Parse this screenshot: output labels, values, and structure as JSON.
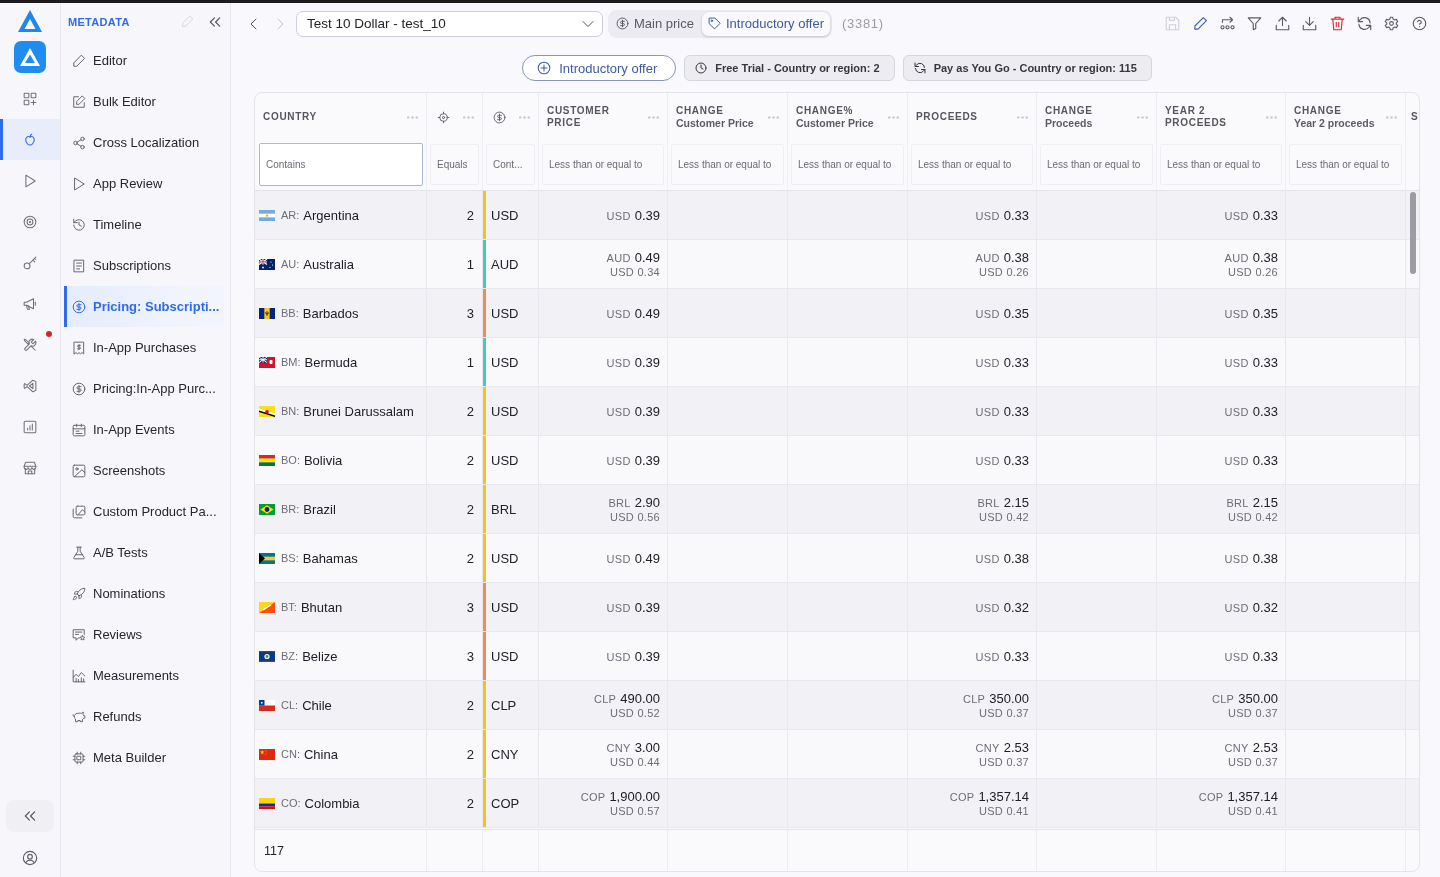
{
  "rail": {
    "items": [
      {
        "kind": "grid",
        "selected": false,
        "badge": false
      },
      {
        "kind": "apple",
        "selected": true,
        "badge": false
      },
      {
        "kind": "play",
        "selected": false,
        "badge": false
      },
      {
        "kind": "target",
        "selected": false,
        "badge": false
      },
      {
        "kind": "key",
        "selected": false,
        "badge": false
      },
      {
        "kind": "megaphone",
        "selected": false,
        "badge": false
      },
      {
        "kind": "tools",
        "selected": false,
        "badge": true
      },
      {
        "kind": "code",
        "selected": false,
        "badge": false
      },
      {
        "kind": "barchart",
        "selected": false,
        "badge": false
      },
      {
        "kind": "store",
        "selected": false,
        "badge": false
      }
    ]
  },
  "nav": {
    "title": "METADATA",
    "items": [
      {
        "kind": "pencil",
        "label": "Editor",
        "selected": false
      },
      {
        "kind": "edit",
        "label": "Bulk Editor",
        "selected": false
      },
      {
        "kind": "share",
        "label": "Cross Localization",
        "selected": false
      },
      {
        "kind": "play",
        "label": "App Review",
        "selected": false
      },
      {
        "kind": "history",
        "label": "Timeline",
        "selected": false
      },
      {
        "kind": "document",
        "label": "Subscriptions",
        "selected": false
      },
      {
        "kind": "dollar",
        "label": "Pricing: Subscripti...",
        "selected": true
      },
      {
        "kind": "receipt",
        "label": "In-App Purchases",
        "selected": false
      },
      {
        "kind": "dollar",
        "label": "Pricing:In-App Purc...",
        "selected": false
      },
      {
        "kind": "calendar",
        "label": "In-App Events",
        "selected": false
      },
      {
        "kind": "image",
        "label": "Screenshots",
        "selected": false
      },
      {
        "kind": "images",
        "label": "Custom Product Pa...",
        "selected": false
      },
      {
        "kind": "flask",
        "label": "A/B Tests",
        "selected": false
      },
      {
        "kind": "rocket",
        "label": "Nominations",
        "selected": false
      },
      {
        "kind": "review",
        "label": "Reviews",
        "selected": false
      },
      {
        "kind": "chart",
        "label": "Measurements",
        "selected": false
      },
      {
        "kind": "piggybank",
        "label": "Refunds",
        "selected": false
      },
      {
        "kind": "chip",
        "label": "Meta Builder",
        "selected": false
      }
    ]
  },
  "toolbar": {
    "history": [
      {
        "kind": "back",
        "disabled": false
      },
      {
        "kind": "forward",
        "disabled": true
      }
    ],
    "product_select": {
      "value": "Test 10 Dollar - test_10"
    },
    "price_types": [
      {
        "kind": "dollar",
        "label": "Main price",
        "selected": false
      },
      {
        "kind": "tag",
        "label": "Introductory offer",
        "selected": true
      }
    ],
    "count": "(3381)",
    "actions": [
      {
        "kind": "save",
        "disabled": true
      },
      {
        "kind": "pencil",
        "disabled": false
      },
      {
        "kind": "batch",
        "disabled": false
      },
      {
        "kind": "filter",
        "disabled": false
      },
      {
        "kind": "upload",
        "disabled": false
      },
      {
        "kind": "download",
        "disabled": false
      },
      {
        "kind": "delete",
        "disabled": false
      },
      {
        "kind": "refresh",
        "disabled": false
      },
      {
        "kind": "settings",
        "disabled": false
      },
      {
        "kind": "help",
        "disabled": false
      }
    ]
  },
  "offer_tabs": [
    {
      "kind": "add",
      "label": "Introductory offer",
      "selected": true
    },
    {
      "kind": "clock",
      "label": "Free Trial - Country or region: 2",
      "selected": false
    },
    {
      "kind": "refresh",
      "label": "Pay as You Go - Country or region: 115",
      "selected": false
    }
  ],
  "table": {
    "columns": [
      {
        "kind": "text",
        "title": "COUNTRY",
        "menu": true,
        "filter": {
          "placeholder": "Contains",
          "focused": true
        }
      },
      {
        "kind": "crosshair",
        "menu": true,
        "filter": {
          "placeholder": "Equals",
          "focused": false
        }
      },
      {
        "kind": "dollar",
        "menu": true,
        "filter": {
          "placeholder": "Cont...",
          "focused": false
        }
      },
      {
        "kind": "text",
        "title": "CUSTOMER PRICE",
        "menu": true,
        "filter": {
          "placeholder": "Less than or equal to",
          "focused": false
        }
      },
      {
        "kind": "text",
        "title": "CHANGE",
        "subtitle": "Customer Price",
        "menu": true,
        "filter": {
          "placeholder": "Less than or equal to",
          "focused": false
        }
      },
      {
        "kind": "text",
        "title": "CHANGE%",
        "subtitle": "Customer Price",
        "menu": true,
        "filter": {
          "placeholder": "Less than or equal to",
          "focused": false
        }
      },
      {
        "kind": "text",
        "title": "PROCEEDS",
        "menu": true,
        "filter": {
          "placeholder": "Less than or equal to",
          "focused": false
        }
      },
      {
        "kind": "text",
        "title": "CHANGE",
        "subtitle": "Proceeds",
        "menu": true,
        "filter": {
          "placeholder": "Less than or equal to",
          "focused": false
        }
      },
      {
        "kind": "text",
        "title": "YEAR 2 PROCEEDS",
        "menu": true,
        "filter": {
          "placeholder": "Less than or equal to",
          "focused": false
        }
      },
      {
        "kind": "text",
        "title": "CHANGE",
        "subtitle": "Year 2 proceeds",
        "menu": true,
        "filter": {
          "placeholder": "Less than or equal to",
          "focused": false
        }
      },
      {
        "kind": "text",
        "title": "S",
        "menu": false
      }
    ],
    "rows": [
      {
        "country": {
          "code": "AR:",
          "name": "Argentina"
        },
        "column_2": "2",
        "color": "#f5c21b",
        "column_3": "USD",
        "customer_price": {
          "code": "USD",
          "amount": "0.39"
        },
        "proceeds": {
          "code": "USD",
          "amount": "0.33"
        },
        "year_2_proceeds": {
          "code": "USD",
          "amount": "0.33"
        }
      },
      {
        "country": {
          "code": "AU:",
          "name": "Australia"
        },
        "column_2": "1",
        "color": "#3ccfbd",
        "column_3": "AUD",
        "customer_price": {
          "code": "AUD",
          "amount": "0.49",
          "converted": "USD 0.34"
        },
        "proceeds": {
          "code": "AUD",
          "amount": "0.38",
          "converted": "USD 0.26"
        },
        "year_2_proceeds": {
          "code": "AUD",
          "amount": "0.38",
          "converted": "USD 0.26"
        }
      },
      {
        "country": {
          "code": "BB:",
          "name": "Barbados"
        },
        "column_2": "3",
        "color": "#f28b4e",
        "column_3": "USD",
        "customer_price": {
          "code": "USD",
          "amount": "0.49"
        },
        "proceeds": {
          "code": "USD",
          "amount": "0.35"
        },
        "year_2_proceeds": {
          "code": "USD",
          "amount": "0.35"
        }
      },
      {
        "country": {
          "code": "BM:",
          "name": "Bermuda"
        },
        "column_2": "1",
        "color": "#3ccfbd",
        "column_3": "USD",
        "customer_price": {
          "code": "USD",
          "amount": "0.39"
        },
        "proceeds": {
          "code": "USD",
          "amount": "0.33"
        },
        "year_2_proceeds": {
          "code": "USD",
          "amount": "0.33"
        }
      },
      {
        "country": {
          "code": "BN:",
          "name": "Brunei Darussalam"
        },
        "column_2": "2",
        "color": "#f5c21b",
        "column_3": "USD",
        "customer_price": {
          "code": "USD",
          "amount": "0.39"
        },
        "proceeds": {
          "code": "USD",
          "amount": "0.33"
        },
        "year_2_proceeds": {
          "code": "USD",
          "amount": "0.33"
        }
      },
      {
        "country": {
          "code": "BO:",
          "name": "Bolivia"
        },
        "column_2": "2",
        "color": "#f5c21b",
        "column_3": "USD",
        "customer_price": {
          "code": "USD",
          "amount": "0.39"
        },
        "proceeds": {
          "code": "USD",
          "amount": "0.33"
        },
        "year_2_proceeds": {
          "code": "USD",
          "amount": "0.33"
        }
      },
      {
        "country": {
          "code": "BR:",
          "name": "Brazil"
        },
        "column_2": "2",
        "color": "#f5c21b",
        "column_3": "BRL",
        "customer_price": {
          "code": "BRL",
          "amount": "2.90",
          "converted": "USD 0.56"
        },
        "proceeds": {
          "code": "BRL",
          "amount": "2.15",
          "converted": "USD 0.42"
        },
        "year_2_proceeds": {
          "code": "BRL",
          "amount": "2.15",
          "converted": "USD 0.42"
        }
      },
      {
        "country": {
          "code": "BS:",
          "name": "Bahamas"
        },
        "column_2": "2",
        "color": "#f5c21b",
        "column_3": "USD",
        "customer_price": {
          "code": "USD",
          "amount": "0.49"
        },
        "proceeds": {
          "code": "USD",
          "amount": "0.38"
        },
        "year_2_proceeds": {
          "code": "USD",
          "amount": "0.38"
        }
      },
      {
        "country": {
          "code": "BT:",
          "name": "Bhutan"
        },
        "column_2": "3",
        "color": "#f28b4e",
        "column_3": "USD",
        "customer_price": {
          "code": "USD",
          "amount": "0.39"
        },
        "proceeds": {
          "code": "USD",
          "amount": "0.32"
        },
        "year_2_proceeds": {
          "code": "USD",
          "amount": "0.32"
        }
      },
      {
        "country": {
          "code": "BZ:",
          "name": "Belize"
        },
        "column_2": "3",
        "color": "#f28b4e",
        "column_3": "USD",
        "customer_price": {
          "code": "USD",
          "amount": "0.39"
        },
        "proceeds": {
          "code": "USD",
          "amount": "0.33"
        },
        "year_2_proceeds": {
          "code": "USD",
          "amount": "0.33"
        }
      },
      {
        "country": {
          "code": "CL:",
          "name": "Chile"
        },
        "column_2": "2",
        "color": "#f5c21b",
        "column_3": "CLP",
        "customer_price": {
          "code": "CLP",
          "amount": "490.00",
          "converted": "USD 0.52"
        },
        "proceeds": {
          "code": "CLP",
          "amount": "350.00",
          "converted": "USD 0.37"
        },
        "year_2_proceeds": {
          "code": "CLP",
          "amount": "350.00",
          "converted": "USD 0.37"
        }
      },
      {
        "country": {
          "code": "CN:",
          "name": "China"
        },
        "column_2": "2",
        "color": "#f5c21b",
        "column_3": "CNY",
        "customer_price": {
          "code": "CNY",
          "amount": "3.00",
          "converted": "USD 0.44"
        },
        "proceeds": {
          "code": "CNY",
          "amount": "2.53",
          "converted": "USD 0.37"
        },
        "year_2_proceeds": {
          "code": "CNY",
          "amount": "2.53",
          "converted": "USD 0.37"
        }
      },
      {
        "country": {
          "code": "CO:",
          "name": "Colombia"
        },
        "column_2": "2",
        "color": "#f5c21b",
        "column_3": "COP",
        "customer_price": {
          "code": "COP",
          "amount": "1,900.00",
          "converted": "USD 0.57"
        },
        "proceeds": {
          "code": "COP",
          "amount": "1,357.14",
          "converted": "USD 0.41"
        },
        "year_2_proceeds": {
          "code": "COP",
          "amount": "1,357.14",
          "converted": "USD 0.41"
        }
      }
    ],
    "footer": {
      "count": "117"
    }
  }
}
